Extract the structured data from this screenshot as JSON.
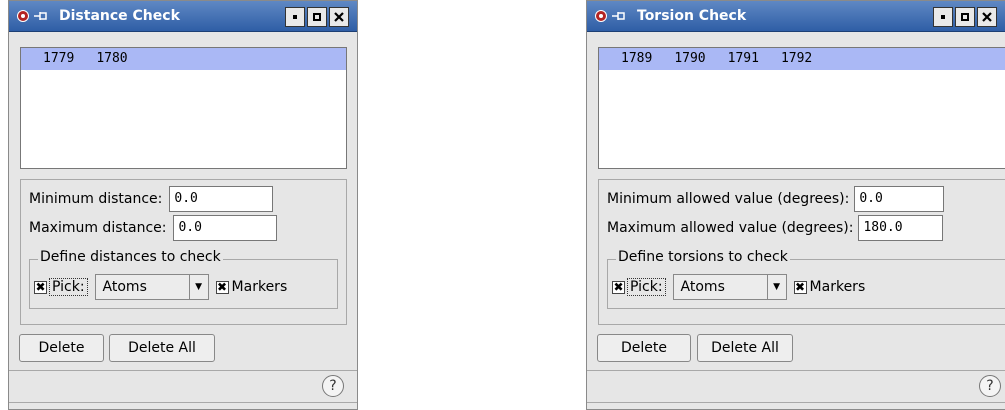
{
  "windows": [
    {
      "title": "Distance Check",
      "list_rows": [
        [
          "1779",
          "1780"
        ]
      ],
      "fields": [
        {
          "label": "Minimum distance:",
          "value": "0.0"
        },
        {
          "label": "Maximum distance:",
          "value": "0.0"
        }
      ],
      "group_title": "Define distances to check",
      "pick_label": "Pick:",
      "pick_checked": true,
      "pick_mode": "Atoms",
      "markers_label": "Markers",
      "markers_checked": true,
      "buttons": {
        "delete": "Delete",
        "delete_all": "Delete All"
      },
      "help": "?"
    },
    {
      "title": "Torsion Check",
      "list_rows": [
        [
          "1789",
          "1790",
          "1791",
          "1792"
        ]
      ],
      "fields": [
        {
          "label": "Minimum allowed value (degrees):",
          "value": "0.0"
        },
        {
          "label": "Maximum allowed value (degrees):",
          "value": "180.0"
        }
      ],
      "group_title": "Define torsions to check",
      "pick_label": "Pick:",
      "pick_checked": true,
      "pick_mode": "Atoms",
      "markers_label": "Markers",
      "markers_checked": true,
      "buttons": {
        "delete": "Delete",
        "delete_all": "Delete All"
      },
      "help": "?"
    }
  ],
  "colors": {
    "titlebar": "#2f5ea6",
    "selection": "#aab8f5",
    "window_bg": "#e6e6e6"
  },
  "icons": [
    "app-icon",
    "pin-icon",
    "minimize-icon",
    "maximize-icon",
    "close-icon",
    "help-icon",
    "dropdown-arrow-icon"
  ]
}
